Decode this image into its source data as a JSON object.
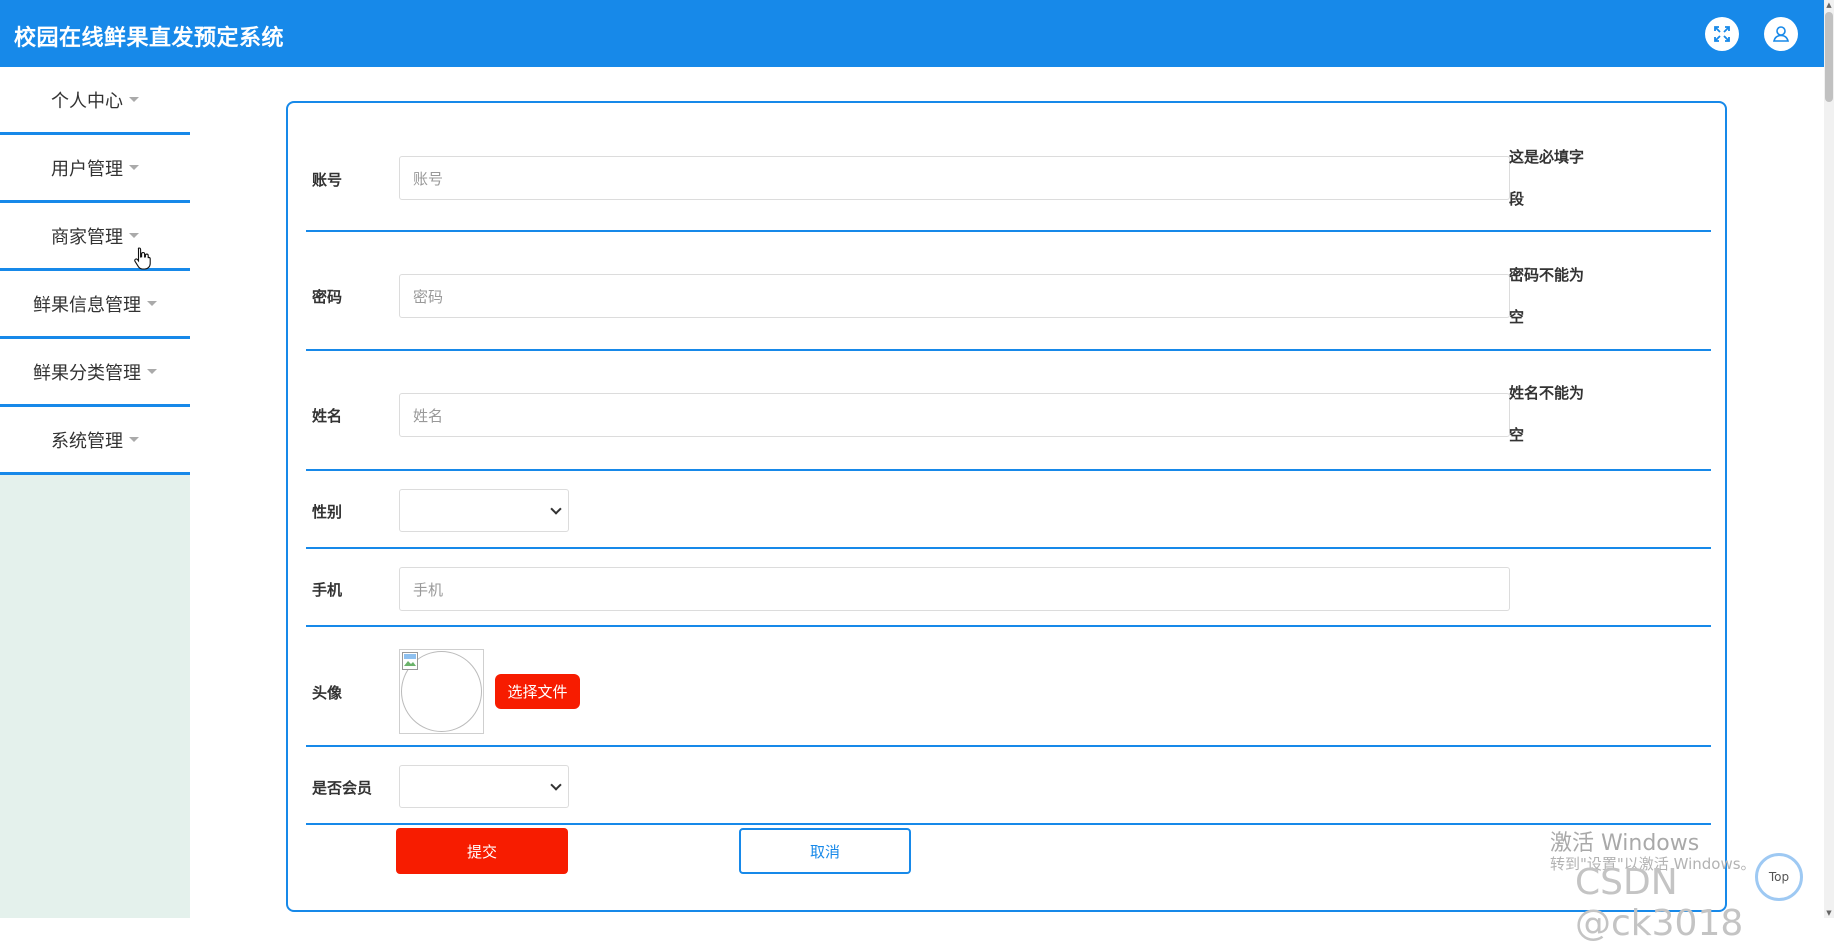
{
  "app": {
    "title": "校园在线鲜果直发预定系统"
  },
  "header": {
    "fullscreen_icon": "expand-icon",
    "user_icon": "user-icon"
  },
  "sidebar": {
    "items": [
      {
        "label": "个人中心"
      },
      {
        "label": "用户管理"
      },
      {
        "label": "商家管理"
      },
      {
        "label": "鲜果信息管理"
      },
      {
        "label": "鲜果分类管理"
      },
      {
        "label": "系统管理"
      }
    ]
  },
  "form": {
    "account": {
      "label": "账号",
      "placeholder": "账号",
      "hint1": "这是必填字",
      "hint2": "段"
    },
    "password": {
      "label": "密码",
      "placeholder": "密码",
      "hint1": "密码不能为",
      "hint2": "空"
    },
    "name": {
      "label": "姓名",
      "placeholder": "姓名",
      "hint1": "姓名不能为",
      "hint2": "空"
    },
    "gender": {
      "label": "性别",
      "value": ""
    },
    "phone": {
      "label": "手机",
      "placeholder": "手机"
    },
    "avatar": {
      "label": "头像",
      "button": "选择文件"
    },
    "member": {
      "label": "是否会员",
      "value": ""
    },
    "submit": "提交",
    "cancel": "取消"
  },
  "watermark": {
    "line1": "激活 Windows",
    "line2": "转到\"设置\"以激活 Windows。",
    "csdn": "CSDN @ck3018"
  },
  "top_button": "Top",
  "colors": {
    "primary": "#1789e9",
    "danger": "#f71c00",
    "sidebar_bg": "#e4f1ec"
  }
}
